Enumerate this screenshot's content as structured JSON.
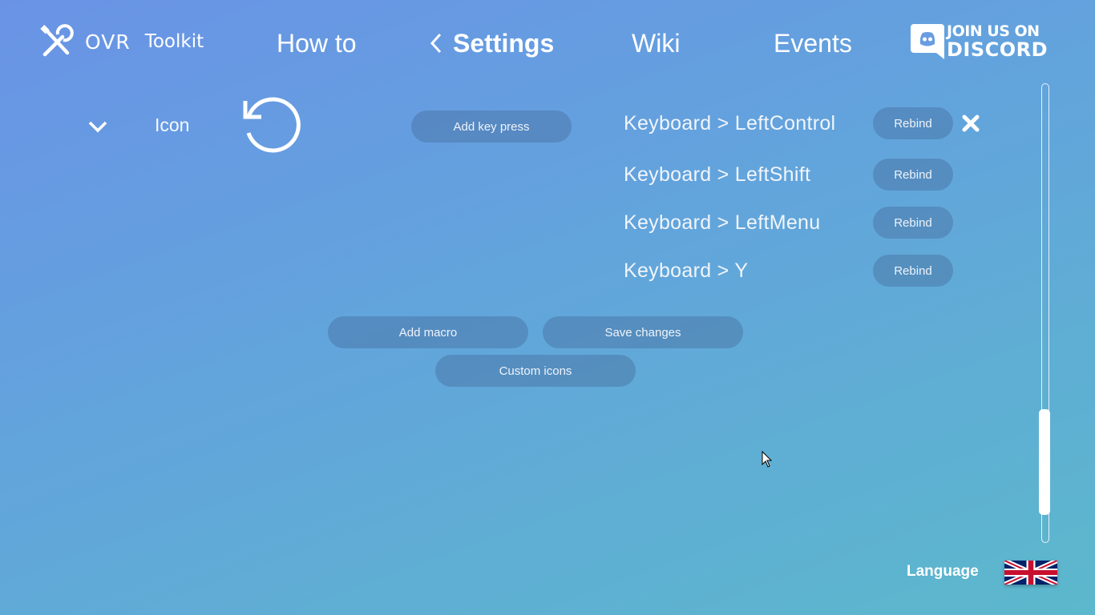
{
  "header": {
    "logo_ovr": "OVR",
    "logo_toolkit": "Toolkit",
    "logo_icon": "tools-icon",
    "nav": {
      "how_to": "How to",
      "settings": "Settings",
      "wiki": "Wiki",
      "events": "Events"
    },
    "discord": {
      "line1": "JOIN US ON",
      "line2": "DISCORD",
      "icon": "discord-icon"
    }
  },
  "macro": {
    "icon_label": "Icon",
    "add_key_press": "Add key press",
    "bindings": [
      {
        "label": "Keyboard > LeftControl",
        "button": "Rebind"
      },
      {
        "label": "Keyboard > LeftShift",
        "button": "Rebind"
      },
      {
        "label": "Keyboard > LeftMenu",
        "button": "Rebind"
      },
      {
        "label": "Keyboard > Y",
        "button": "Rebind"
      }
    ]
  },
  "actions": {
    "add_macro": "Add macro",
    "save_changes": "Save changes",
    "custom_icons": "Custom icons"
  },
  "footer": {
    "language": "Language",
    "flag": "uk-flag-icon"
  },
  "colors": {
    "pill": "#466ea0",
    "text": "#ffffff",
    "gradient_start": "#6a93e6",
    "gradient_end": "#5cb8cc"
  }
}
